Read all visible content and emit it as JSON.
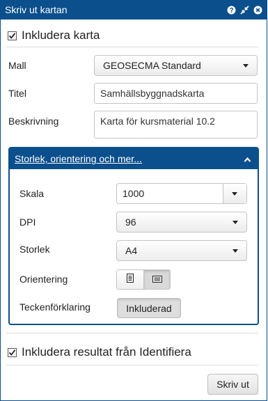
{
  "window": {
    "title": "Skriv ut kartan",
    "icons": [
      "help-icon",
      "collapse-icon",
      "close-icon"
    ]
  },
  "include_map": {
    "label": "Inkludera karta",
    "checked": true
  },
  "form": {
    "template": {
      "label": "Mall",
      "value": "GEOSECMA Standard"
    },
    "title": {
      "label": "Titel",
      "value": "Samhällsbyggnadskarta"
    },
    "description": {
      "label": "Beskrivning",
      "value": "Karta för kursmaterial 10.2"
    }
  },
  "section": {
    "title": "Storlek, orientering och mer...",
    "expanded": true,
    "scale": {
      "label": "Skala",
      "value": "1000"
    },
    "dpi": {
      "label": "DPI",
      "value": "96"
    },
    "size": {
      "label": "Storlek",
      "value": "A4"
    },
    "orientation": {
      "label": "Orientering",
      "options": [
        "portrait-icon",
        "landscape-icon"
      ],
      "selected": "landscape-icon"
    },
    "legend": {
      "label": "Teckenförklaring",
      "button": "Inkluderad"
    }
  },
  "include_identify": {
    "label": "Inkludera resultat från Identifiera",
    "checked": true
  },
  "actions": {
    "print_label": "Skriv ut"
  },
  "colors": {
    "accent": "#0b4f8c"
  }
}
